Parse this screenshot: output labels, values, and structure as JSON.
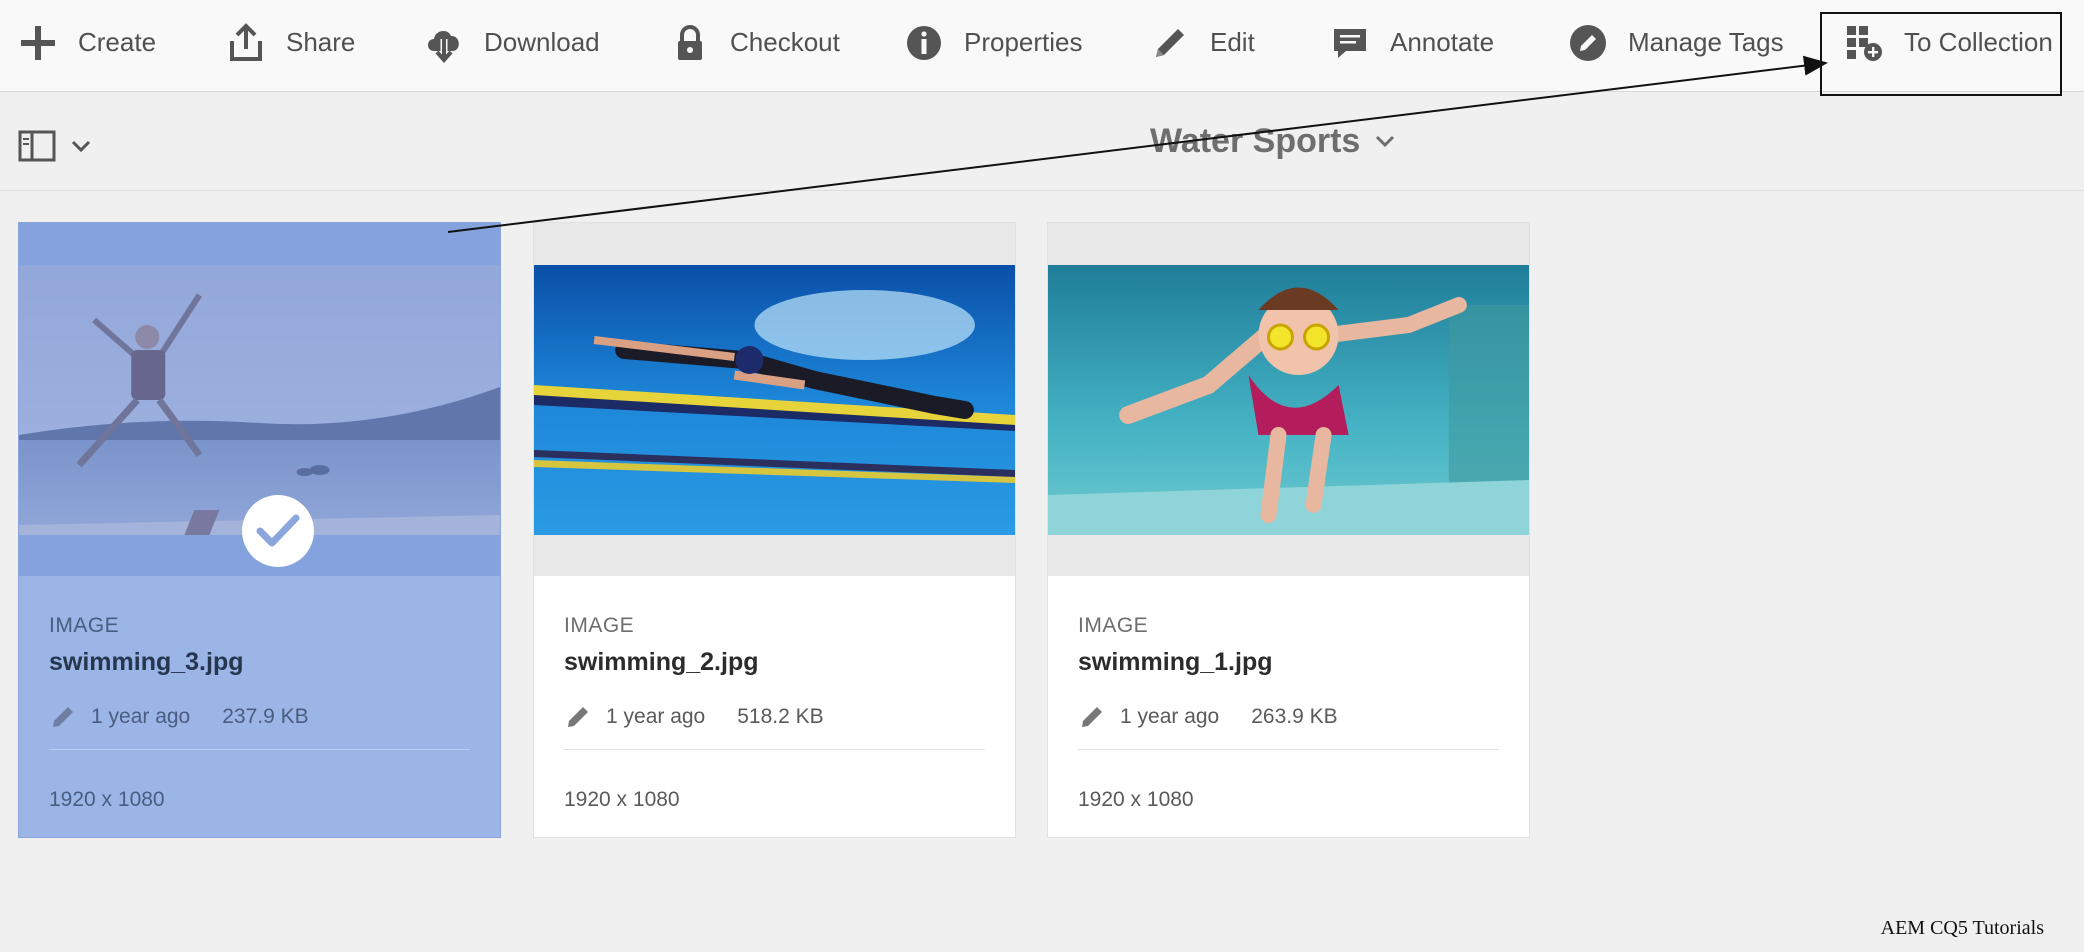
{
  "toolbar": {
    "create": "Create",
    "share": "Share",
    "download": "Download",
    "checkout": "Checkout",
    "properties": "Properties",
    "edit": "Edit",
    "annotate": "Annotate",
    "manage_tags": "Manage Tags",
    "to_collection": "To Collection"
  },
  "header": {
    "title": "Water Sports"
  },
  "assets": [
    {
      "type": "IMAGE",
      "name": "swimming_3.jpg",
      "modified": "1 year ago",
      "size": "237.9 KB",
      "dimensions": "1920 x 1080",
      "selected": true
    },
    {
      "type": "IMAGE",
      "name": "swimming_2.jpg",
      "modified": "1 year ago",
      "size": "518.2 KB",
      "dimensions": "1920 x 1080",
      "selected": false
    },
    {
      "type": "IMAGE",
      "name": "swimming_1.jpg",
      "modified": "1 year ago",
      "size": "263.9 KB",
      "dimensions": "1920 x 1080",
      "selected": false
    }
  ],
  "credit": "AEM CQ5 Tutorials",
  "colors": {
    "selection": "#9ab5e6",
    "toolbar_bg": "#f9f9f9",
    "page_bg": "#f0f0f0"
  }
}
